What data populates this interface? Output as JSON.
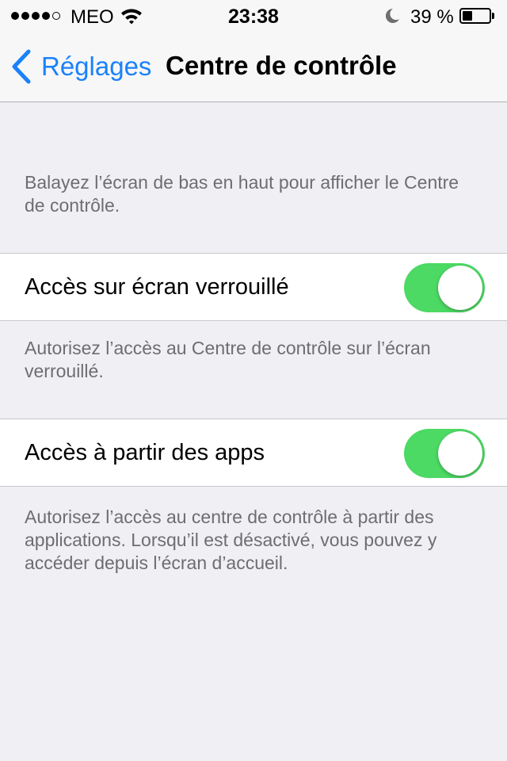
{
  "status_bar": {
    "carrier": "MEO",
    "time": "23:38",
    "battery_percent": "39 %",
    "battery_level": 0.39,
    "signal_bars_filled": 4,
    "signal_bars_total": 5,
    "icons": [
      "signal-dots-icon",
      "wifi-icon",
      "moon-icon",
      "battery-icon"
    ]
  },
  "nav": {
    "back_label": "Réglages",
    "title": "Centre de contrôle",
    "icons": [
      "chevron-left-icon"
    ]
  },
  "content": {
    "intro": "Balayez l’écran de bas en haut pour afficher le Centre de contrôle.",
    "settings": [
      {
        "label": "Accès sur écran verrouillé",
        "enabled": true,
        "footer": "Autorisez l’accès au Centre de contrôle sur l’écran verrouillé."
      },
      {
        "label": "Accès à partir des apps",
        "enabled": true,
        "footer": "Autorisez l’accès au centre de contrôle à partir des applications. Lorsqu’il est désactivé, vous pouvez y accéder depuis l’écran d’accueil."
      }
    ]
  },
  "colors": {
    "accent": "#1a82fb",
    "toggle_on": "#4cd964",
    "background": "#efeff4",
    "footer_text": "#6d6d72"
  }
}
